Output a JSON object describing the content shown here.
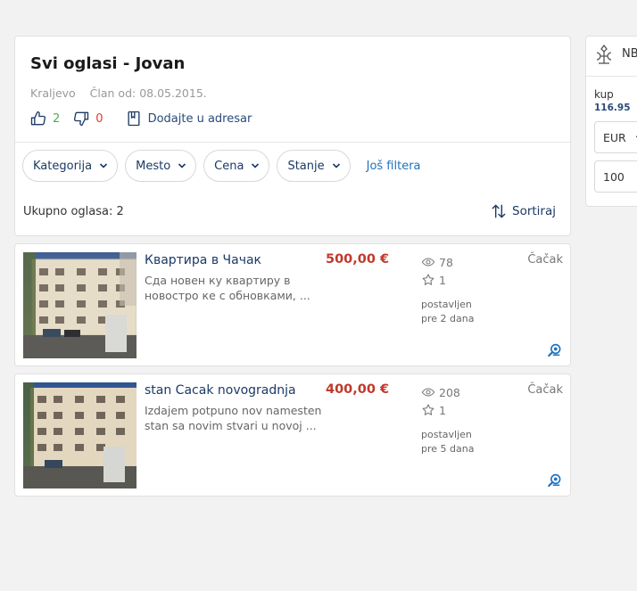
{
  "profile": {
    "title": "Svi oglasi - Jovan",
    "location": "Kraljevo",
    "member_since": "Član od: 08.05.2015.",
    "likes": "2",
    "dislikes": "0",
    "add_to_addressbook": "Dodajte u adresar"
  },
  "filters": {
    "items": [
      "Kategorija",
      "Mesto",
      "Cena",
      "Stanje"
    ],
    "more": "Još filtera"
  },
  "results": {
    "total": "Ukupno oglasa: 2",
    "sort_label": "Sortiraj"
  },
  "listings": [
    {
      "title": "Квартира в Чачак",
      "description": "Сда новен ку квартиру в новостро ке с обновками, ...",
      "price": "500,00 €",
      "views": "78",
      "favorites": "1",
      "posted_label": "postavljen",
      "posted_ago": "pre 2 dana",
      "city": "Čačak"
    },
    {
      "title": "stan Cacak novogradnja",
      "description": "Izdajem potpuno nov namesten stan sa novim stvari u novoj ...",
      "price": "400,00 €",
      "views": "208",
      "favorites": "1",
      "posted_label": "postavljen",
      "posted_ago": "pre 5 dana",
      "city": "Čačak"
    }
  ],
  "rates": {
    "name": "NB",
    "buy_label": "kup",
    "buy_value": "116.95",
    "currency": "EUR",
    "amount": "100"
  },
  "colors": {
    "accent_link": "#1e73be",
    "price": "#c0392b",
    "like": "#4caf50",
    "dislike": "#e53935"
  },
  "icons": {
    "like": "thumbs-up-icon",
    "dislike": "thumbs-down-icon",
    "addressbook": "bookmark-icon",
    "sort": "sort-arrows-icon",
    "views": "eye-icon",
    "favorite": "star-icon",
    "zoom": "zoom-icon"
  }
}
